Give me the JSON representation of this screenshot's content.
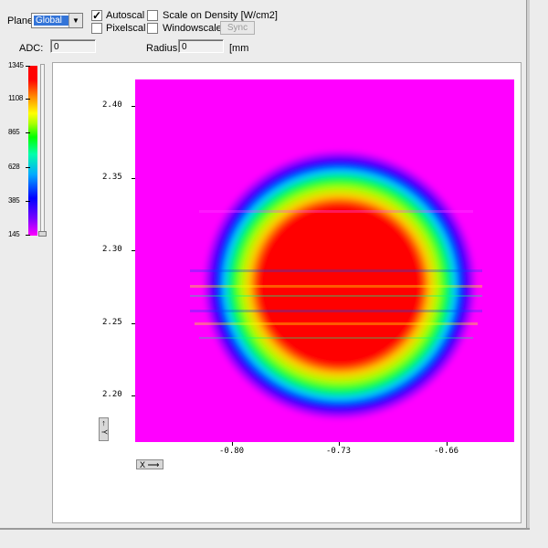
{
  "toolbar": {
    "plane_label": "Plane:",
    "plane_value": "Global",
    "autoscale_label": "Autoscal",
    "autoscale_checked": true,
    "pixelscale_label": "Pixelscal",
    "pixelscale_checked": false,
    "scale_density_label": "Scale on Density [W/cm2]",
    "scale_density_checked": false,
    "windowscale_label": "Windowscale",
    "windowscale_checked": false,
    "sync_label": "Sync",
    "adc_label": "ADC:",
    "adc_value": "0",
    "radius_label": "Radius:",
    "radius_value": "0",
    "radius_unit": "[mm"
  },
  "colorbar": {
    "ticks": [
      "1345",
      "1108",
      "865",
      "628",
      "385",
      "145"
    ]
  },
  "plot": {
    "y_ticks": [
      "2.40",
      "2.35",
      "2.30",
      "2.25",
      "2.20"
    ],
    "x_ticks": [
      "-0.80",
      "-0.73",
      "-0.66"
    ],
    "y_axis_button": "Y",
    "x_axis_button": "X"
  }
}
